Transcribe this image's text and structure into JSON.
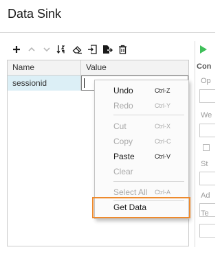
{
  "panel": {
    "title": "Data Sink"
  },
  "toolbar": {
    "items": [
      {
        "name": "add-icon",
        "enabled": true
      },
      {
        "name": "move-up-icon",
        "enabled": false
      },
      {
        "name": "move-down-icon",
        "enabled": false
      },
      {
        "name": "sort-icon",
        "enabled": true
      },
      {
        "name": "eraser-icon",
        "enabled": true
      },
      {
        "name": "import-icon",
        "enabled": true
      },
      {
        "name": "export-icon",
        "enabled": true
      },
      {
        "name": "trash-icon",
        "enabled": true
      }
    ]
  },
  "table": {
    "columns": [
      "Name",
      "Value"
    ],
    "rows": [
      {
        "name": "sessionid",
        "value": ""
      }
    ]
  },
  "right_pane": {
    "labels": [
      "Con",
      "Op",
      "We",
      "St",
      "Ad",
      "Te"
    ]
  },
  "context_menu": {
    "items": [
      {
        "label": "Undo",
        "shortcut": "Ctrl-Z",
        "enabled": true
      },
      {
        "label": "Redo",
        "shortcut": "Ctrl-Y",
        "enabled": false
      },
      {
        "label": "Cut",
        "shortcut": "Ctrl-X",
        "enabled": false
      },
      {
        "label": "Copy",
        "shortcut": "Ctrl-C",
        "enabled": false
      },
      {
        "label": "Paste",
        "shortcut": "Ctrl-V",
        "enabled": true
      },
      {
        "label": "Clear",
        "shortcut": "",
        "enabled": false
      },
      {
        "label": "Select All",
        "shortcut": "Ctrl-A",
        "enabled": false
      },
      {
        "label": "Get Data",
        "shortcut": "",
        "enabled": true,
        "highlighted": true
      }
    ]
  },
  "colors": {
    "highlight_outline": "#ee8a2d",
    "selected_row": "#dceff6",
    "run_icon": "#3fbf5a"
  }
}
